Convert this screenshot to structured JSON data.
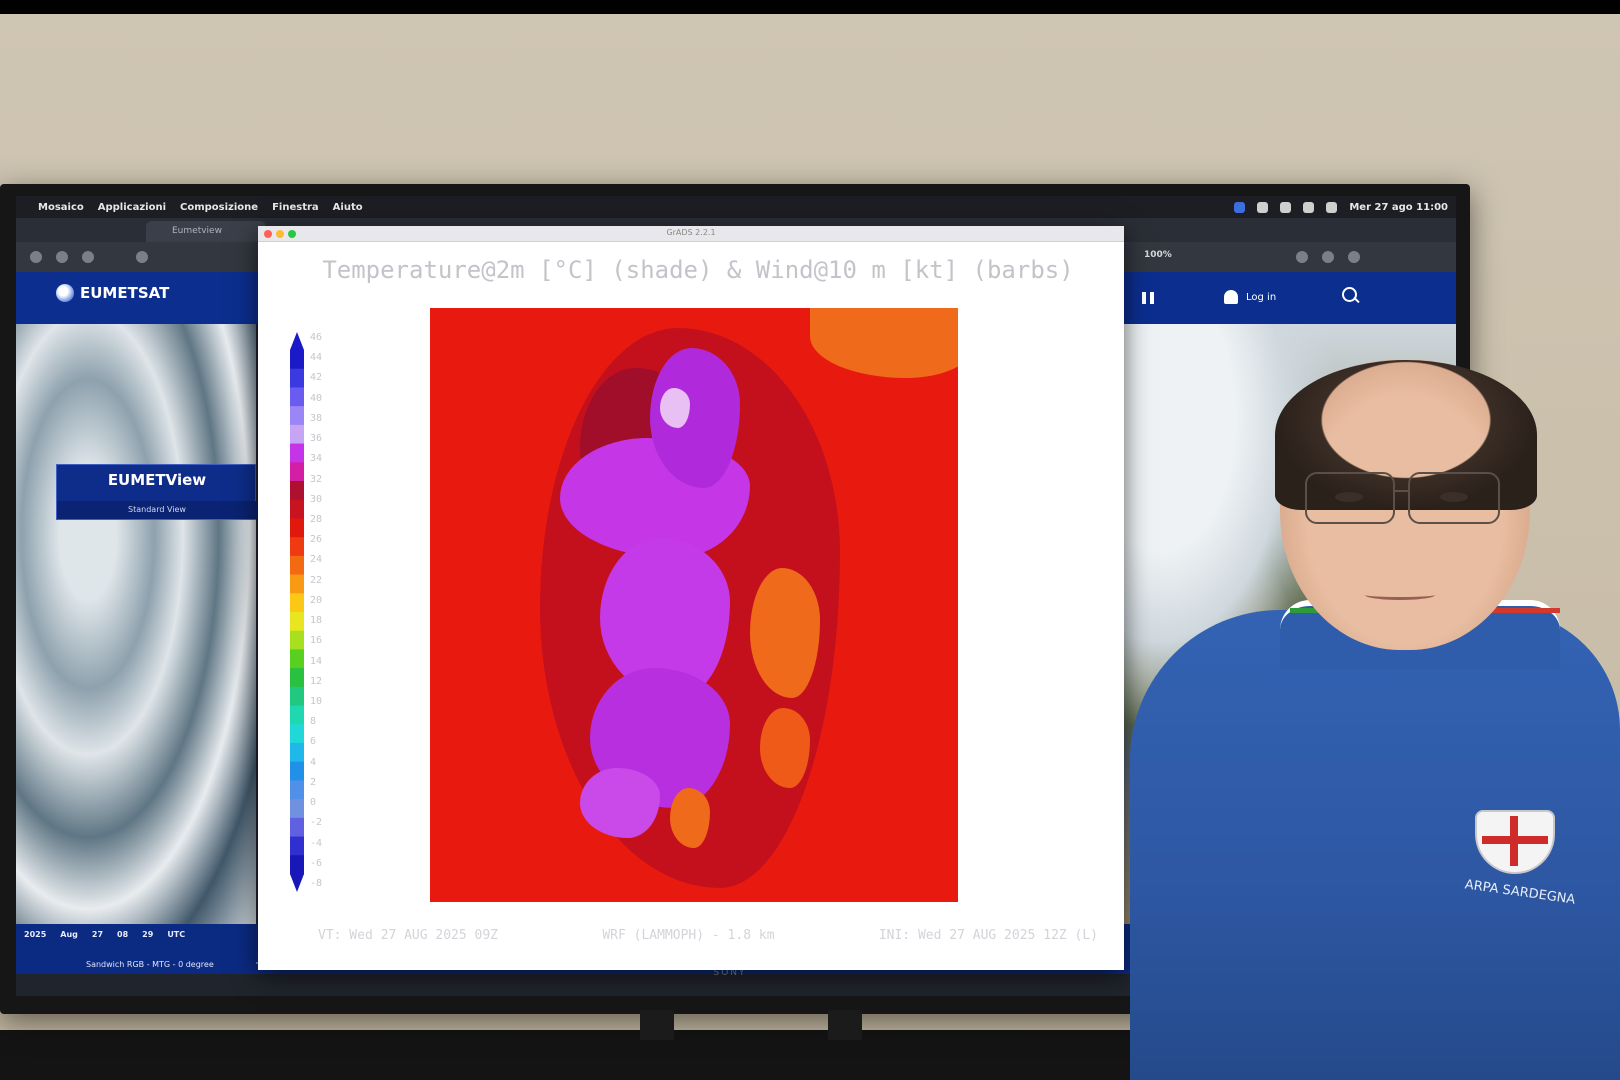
{
  "menubar": {
    "items": [
      "Mosaico",
      "Applicazioni",
      "Composizione",
      "Finestra",
      "Aiuto"
    ],
    "clock": "Mer 27 ago 11:00"
  },
  "browser": {
    "tab_title": "Eumetview",
    "zoom": "100%"
  },
  "eumetsat": {
    "logo": "EUMETSAT",
    "panel_title": "EUMETView",
    "panel_sub": "Standard View",
    "login": "Log in",
    "timeline": {
      "dates": [
        "2025",
        "Aug",
        "27",
        "08",
        "29",
        "UTC"
      ],
      "layer": "Sandwich RGB - MTG - 0 degree"
    }
  },
  "plot": {
    "window_title": "GrADS 2.2.1",
    "title": "Temperature@2m [°C] (shade) & Wind@10 m [kt] (barbs)",
    "colorbar": {
      "labels": [
        "46",
        "44",
        "42",
        "40",
        "38",
        "36",
        "34",
        "32",
        "30",
        "28",
        "26",
        "24",
        "22",
        "20",
        "18",
        "16",
        "14",
        "12",
        "10",
        "8",
        "6",
        "4",
        "2",
        "0",
        "-2",
        "-4",
        "-6",
        "-8"
      ],
      "colors": [
        "#1a1ac8",
        "#3a3ae0",
        "#6a5cf0",
        "#9a86f4",
        "#c6a6f4",
        "#c434e8",
        "#d41ea6",
        "#b01030",
        "#c81420",
        "#e0180e",
        "#f03a12",
        "#f46a12",
        "#f89a14",
        "#fbc816",
        "#e8e620",
        "#a8e020",
        "#58d020",
        "#2ac040",
        "#20c880",
        "#20d8b0",
        "#20d8d8",
        "#20b8e8",
        "#2090e8",
        "#5090e8",
        "#7090e0",
        "#6060e0",
        "#3030d0",
        "#1818b8"
      ]
    },
    "footer_left": "VT: Wed 27 AUG 2025 09Z",
    "footer_mid": "WRF (LAMMOPH) - 1.8 km",
    "footer_right": "INI: Wed 27 AUG 2025 12Z (L)"
  },
  "presenter": {
    "logo_text": "ARPA SARDEGNA"
  },
  "monitor": {
    "brand": "SONY"
  }
}
